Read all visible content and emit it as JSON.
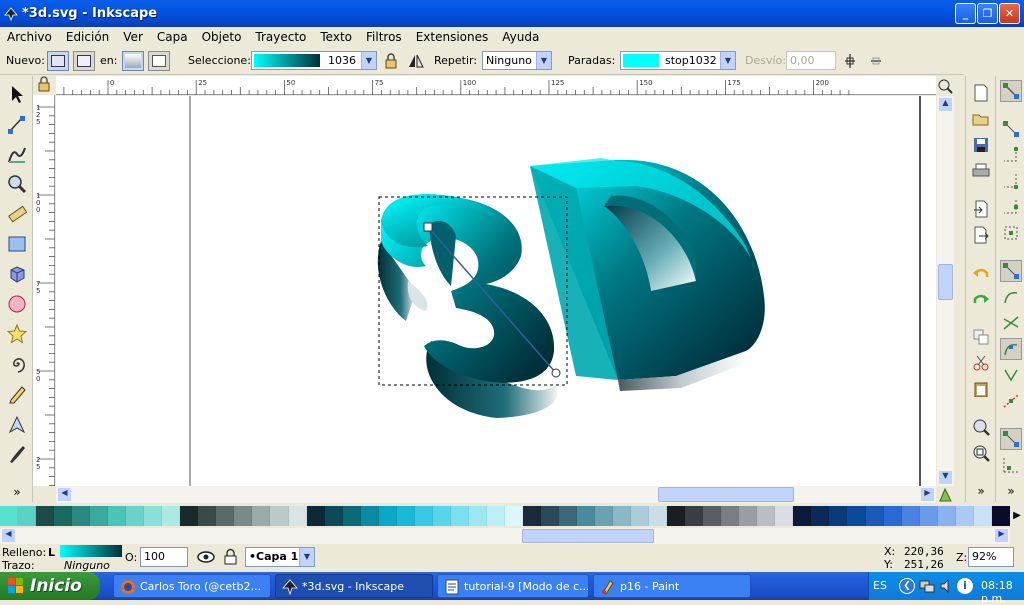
{
  "window": {
    "title": "*3d.svg - Inkscape"
  },
  "menu": [
    "Archivo",
    "Edición",
    "Ver",
    "Capa",
    "Objeto",
    "Trayecto",
    "Texto",
    "Filtros",
    "Extensiones",
    "Ayuda"
  ],
  "toolbar": {
    "nuevo_label": "Nuevo:",
    "en_label": "en:",
    "seleccione_label": "Seleccione:",
    "gradient_name": "1036",
    "repetir_label": "Repetir:",
    "repetir_value": "Ninguno",
    "paradas_label": "Paradas:",
    "stop_name": "stop1032",
    "desvio_label": "Desvío:",
    "desvio_value": "0,00"
  },
  "ruler": {
    "h_ticks": [
      "-25",
      "0",
      "25",
      "50",
      "75",
      "100",
      "125",
      "150",
      "175",
      "200"
    ],
    "v_ticks": [
      "125",
      "100",
      "75",
      "50",
      "25"
    ]
  },
  "canvas": {
    "artwork_text": "3D"
  },
  "palette": [
    "#5ae0d0",
    "#5ad2c8",
    "#1e4a48",
    "#1a6a64",
    "#2a8a82",
    "#3aaa9e",
    "#4ac4b6",
    "#6ad2c6",
    "#8ae0d6",
    "#aaeae0",
    "#1a2a2a",
    "#3a4a4a",
    "#5a6a6a",
    "#7a8a8a",
    "#9aaaaa",
    "#bacaca",
    "#dae4e4",
    "#0a2a3a",
    "#0a4a5a",
    "#0a6a7a",
    "#0a8aa4",
    "#0aa8c8",
    "#1ab8d8",
    "#3ac8e4",
    "#5ad4ea",
    "#7ae0f0",
    "#9ae8f4",
    "#bcf0f8",
    "#dcf6fa",
    "#1a2a3a",
    "#2a4a5a",
    "#3a6a7a",
    "#4a8a9e",
    "#6aa2b4",
    "#8ab8c8",
    "#aaccd8",
    "#cadee6",
    "#1a1e24",
    "#3a3e44",
    "#5a5e64",
    "#7a7e84",
    "#9a9ea4",
    "#babec4",
    "#dadee4",
    "#0a1a3a",
    "#0a2a5a",
    "#0a3a7a",
    "#0a4a9a",
    "#1a5ab8",
    "#2a6ad4",
    "#4a82e0",
    "#6a9ae8",
    "#8ab2ee",
    "#aacaf4",
    "#cae0f8",
    "#0a0a2a"
  ],
  "status": {
    "relleno_label": "Relleno:",
    "relleno_type": "L",
    "trazo_label": "Trazo:",
    "trazo_value": "Ninguno",
    "opacity_label": "O:",
    "opacity_value": "100",
    "layer_value": "•Capa 1",
    "x_label": "X:",
    "x_value": "220,36",
    "y_label": "Y:",
    "y_value": "251,26",
    "zoom_label": "Z:",
    "zoom_value": "92%"
  },
  "taskbar": {
    "start_label": "Inicio",
    "tasks": [
      "Carlos Toro (@cetb2...",
      "*3d.svg - Inkscape",
      "tutorial-9 [Modo de c...",
      "p16 - Paint"
    ],
    "lang": "ES",
    "clock": "08:18 p.m."
  },
  "colors": {
    "accent": "#0054e3",
    "gradient_start": "#00ffff",
    "gradient_end": "#00303a"
  }
}
